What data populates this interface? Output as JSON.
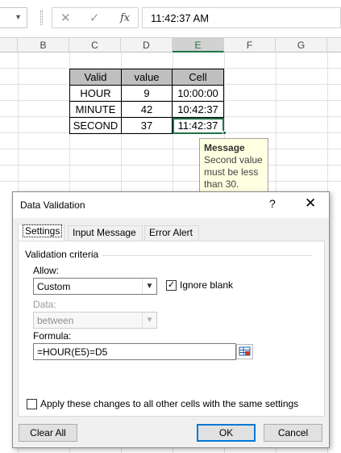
{
  "formula_bar": {
    "cancel_glyph": "✕",
    "enter_glyph": "✓",
    "fx_label": "fx",
    "value": "11:42:37 AM"
  },
  "columns": [
    "B",
    "C",
    "D",
    "E",
    "F",
    "G"
  ],
  "table": {
    "headers": [
      "Valid",
      "value",
      "Cell"
    ],
    "rows": [
      [
        "HOUR",
        "9",
        "10:00:00"
      ],
      [
        "MINUTE",
        "42",
        "10:42:37"
      ],
      [
        "SECOND",
        "37",
        "11:42:37"
      ]
    ]
  },
  "input_message": {
    "title": "Message",
    "body_line1": "Second value",
    "body_line2": "must be less",
    "body_line3": "than 30."
  },
  "dialog": {
    "title": "Data Validation",
    "help": "?",
    "close": "✕",
    "tabs": [
      "Settings",
      "Input Message",
      "Error Alert"
    ],
    "group_label": "Validation criteria",
    "allow_label": "Allow:",
    "allow_value": "Custom",
    "ignore_blank_label": "Ignore blank",
    "ignore_blank_checked": true,
    "data_label": "Data:",
    "data_value": "between",
    "formula_label": "Formula:",
    "formula_value": "=HOUR(E5)=D5",
    "apply_label": "Apply these changes to all other cells with the same settings",
    "clear_all": "Clear All",
    "ok": "OK",
    "cancel": "Cancel"
  }
}
